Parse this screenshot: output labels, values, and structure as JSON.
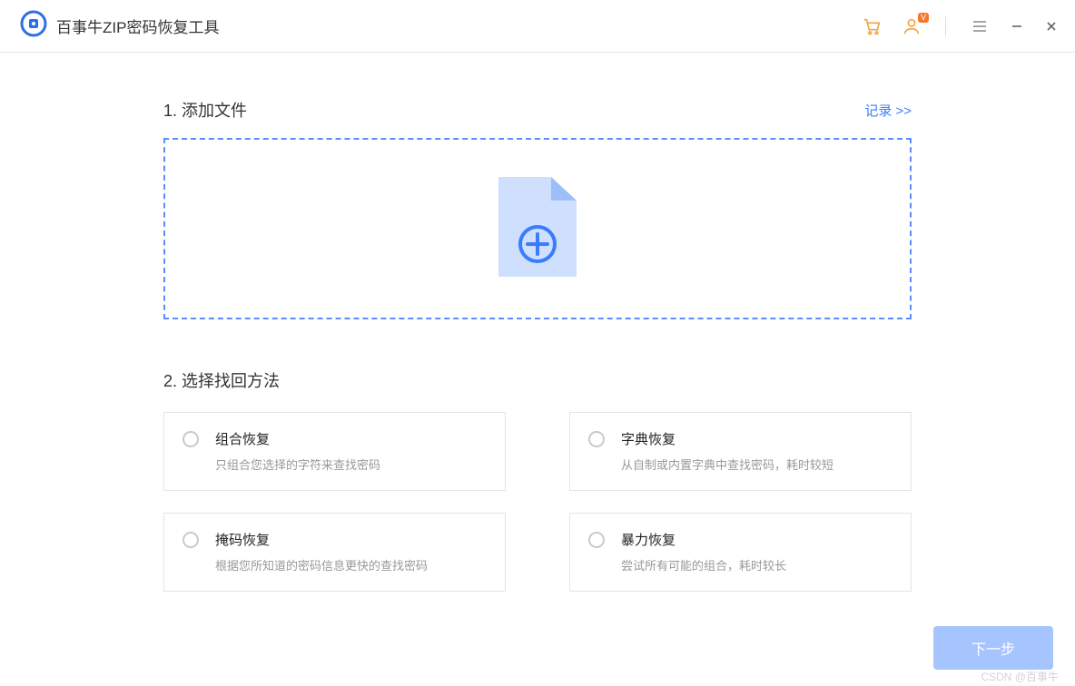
{
  "app": {
    "title": "百事牛ZIP密码恢复工具"
  },
  "header": {
    "badge": "V"
  },
  "section1": {
    "title": "1. 添加文件",
    "records_link": "记录 >>"
  },
  "section2": {
    "title": "2. 选择找回方法"
  },
  "options": [
    {
      "title": "组合恢复",
      "desc": "只组合您选择的字符来查找密码"
    },
    {
      "title": "字典恢复",
      "desc": "从自制或内置字典中查找密码，耗时较短"
    },
    {
      "title": "掩码恢复",
      "desc": "根据您所知道的密码信息更快的查找密码"
    },
    {
      "title": "暴力恢复",
      "desc": "尝试所有可能的组合，耗时较长"
    }
  ],
  "footer": {
    "next": "下一步"
  },
  "watermark": "CSDN @百事牛"
}
